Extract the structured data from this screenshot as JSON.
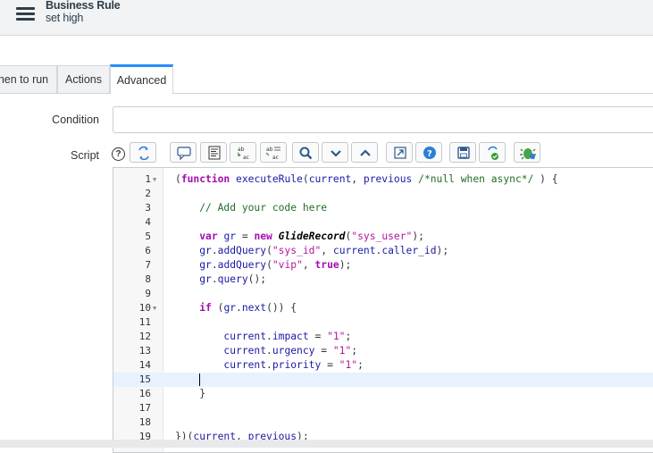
{
  "header": {
    "title": "Business Rule",
    "subtitle": "set high"
  },
  "tabs": [
    {
      "label": "When to run",
      "visible_text": "hen to run"
    },
    {
      "label": "Actions"
    },
    {
      "label": "Advanced"
    }
  ],
  "form": {
    "condition_label": "Condition",
    "condition_value": "",
    "script_label": "Script",
    "help_glyph": "?"
  },
  "toolbar": {
    "buttons": [
      "toggle-syntax-editor-icon",
      "comment-icon",
      "format-code-icon",
      "replace-icon",
      "replace-all-icon",
      "search-icon",
      "collapse-icon",
      "expand-icon",
      "fullscreen-icon",
      "help-icon",
      "save-icon",
      "script-debugger-icon",
      "debug-icon"
    ]
  },
  "editor": {
    "lines": [
      {
        "n": "1",
        "fold": true,
        "text": "(function executeRule(current, previous /*null when async*/ ) {"
      },
      {
        "n": "2",
        "text": ""
      },
      {
        "n": "3",
        "text": "    // Add your code here"
      },
      {
        "n": "4",
        "text": ""
      },
      {
        "n": "5",
        "text": "    var gr = new GlideRecord(\"sys_user\");"
      },
      {
        "n": "6",
        "text": "    gr.addQuery(\"sys_id\", current.caller_id);"
      },
      {
        "n": "7",
        "text": "    gr.addQuery(\"vip\", true);"
      },
      {
        "n": "8",
        "text": "    gr.query();"
      },
      {
        "n": "9",
        "text": ""
      },
      {
        "n": "10",
        "fold": true,
        "text": "    if (gr.next()) {"
      },
      {
        "n": "11",
        "text": ""
      },
      {
        "n": "12",
        "text": "        current.impact = \"1\";"
      },
      {
        "n": "13",
        "text": "        current.urgency = \"1\";"
      },
      {
        "n": "14",
        "text": "        current.priority = \"1\";"
      },
      {
        "n": "15",
        "text": "",
        "active": true
      },
      {
        "n": "16",
        "text": "    }"
      },
      {
        "n": "17",
        "text": ""
      },
      {
        "n": "18",
        "text": ""
      },
      {
        "n": "19",
        "text": "})(current, previous);"
      }
    ]
  }
}
